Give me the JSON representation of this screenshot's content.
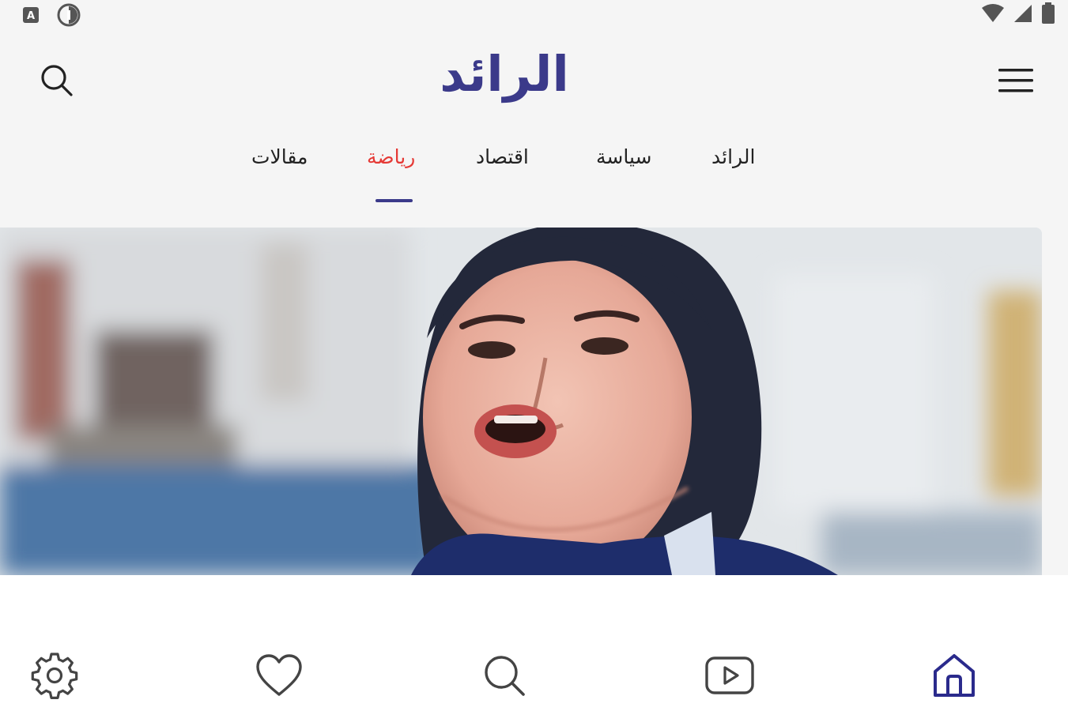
{
  "status_bar": {
    "left_icons": [
      "notification-a-icon",
      "data-saver-icon"
    ],
    "right_icons": [
      "wifi-icon",
      "cell-signal-icon",
      "battery-icon"
    ]
  },
  "app_bar": {
    "logo_text": "الرائد",
    "brand_color": "#3b3a8a"
  },
  "tabs": [
    {
      "label": "الرائد",
      "active": false
    },
    {
      "label": "سياسة",
      "active": false
    },
    {
      "label": "اقتصاد",
      "active": false
    },
    {
      "label": "رياضة",
      "active": true
    },
    {
      "label": "مقالات",
      "active": false
    }
  ],
  "colors": {
    "active_tab": "#e53935",
    "indicator": "#3b3a8a",
    "nav_active": "#2a2a8c",
    "nav_inactive": "#444444"
  },
  "bottom_nav": [
    {
      "icon": "gear-icon",
      "active": false
    },
    {
      "icon": "heart-icon",
      "active": false
    },
    {
      "icon": "search-icon",
      "active": false
    },
    {
      "icon": "video-play-icon",
      "active": false
    },
    {
      "icon": "home-icon",
      "active": true
    }
  ]
}
